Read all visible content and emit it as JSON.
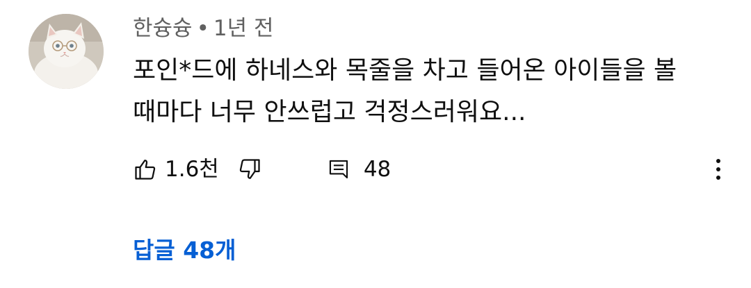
{
  "comment": {
    "author": "한슝슝",
    "separator": "•",
    "time": "1년 전",
    "text": "포인*드에 하네스와 목줄을 차고 들어온 아이들을 볼 때마다 너무 안쓰럽고 걱정스러워요...",
    "avatar_icon": "white-cat-avatar"
  },
  "actions": {
    "like_icon": "thumbs-up-icon",
    "like_count": "1.6천",
    "dislike_icon": "thumbs-down-icon",
    "reply_icon": "comment-icon",
    "reply_count": "48",
    "more_icon": "more-vertical-icon"
  },
  "replies": {
    "label": "답글 48개",
    "color": "#065fd4"
  },
  "colors": {
    "text_primary": "#0f0f0f",
    "text_secondary": "#606060",
    "link": "#065fd4"
  }
}
